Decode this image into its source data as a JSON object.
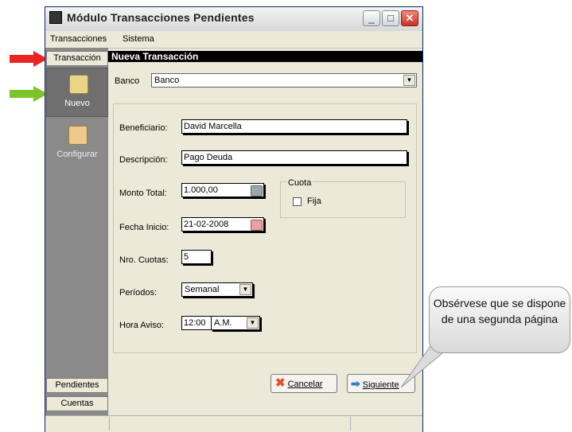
{
  "window": {
    "title": "Módulo Transacciones Pendientes"
  },
  "menu": {
    "items": [
      "Transacciones",
      "Sistema"
    ]
  },
  "left_panel": {
    "tab_transaccion": "Transacción",
    "nav": [
      {
        "label": "Nuevo",
        "icon": "new-folder-icon",
        "selected": true
      },
      {
        "label": "Configurar",
        "icon": "configure-icon",
        "selected": false
      }
    ],
    "tab_pendientes": "Pendientes",
    "tab_cuentas": "Cuentas"
  },
  "form": {
    "header": "Nueva Transacción",
    "banco_label": "Banco",
    "banco_value": "Banco",
    "beneficiario_label": "Beneficiario:",
    "beneficiario_value": "David Marcella",
    "descripcion_label": "Descripción:",
    "descripcion_value": "Pago Deuda",
    "monto_label": "Monto Total:",
    "monto_value": "1.000,00",
    "fecha_label": "Fecha Inicio:",
    "fecha_value": "21-02-2008",
    "cuotas_label": "Nro. Cuotas:",
    "cuotas_value": "5",
    "periodos_label": "Períodos:",
    "periodos_value": "Semanal",
    "hora_label": "Hora Aviso:",
    "hora_value": "12:00",
    "ampm_value": "A.M.",
    "cuota_group_label": "Cuota",
    "fija_label": "Fija",
    "fija_checked": false
  },
  "buttons": {
    "cancel": "Cancelar",
    "next": "Siguiente"
  },
  "callout": {
    "text": "Obsérvese que se dispone de una segunda página"
  },
  "colors": {
    "red_arrow": "#e8251f",
    "green_arrow": "#7cc42a",
    "header_bar": "#000000",
    "side_panel": "#8a8a8a"
  }
}
